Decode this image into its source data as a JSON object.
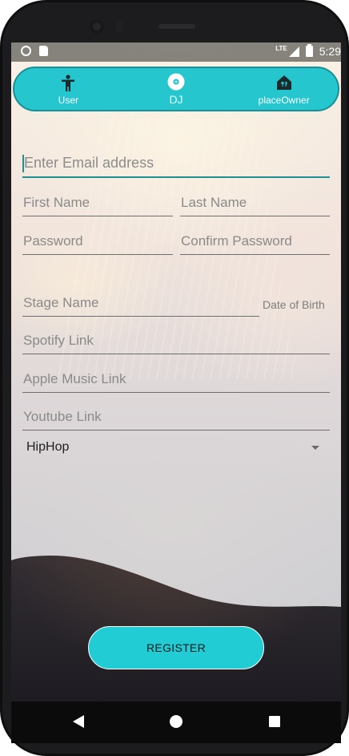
{
  "statusbar": {
    "network": "LTE",
    "time": "5:29"
  },
  "tabs": [
    {
      "label": "User",
      "icon": "accessibility-person-icon"
    },
    {
      "label": "DJ",
      "icon": "disc-icon",
      "selected": true
    },
    {
      "label": "placeOwner",
      "icon": "restaurant-home-icon"
    }
  ],
  "form": {
    "email_placeholder": "Enter Email address",
    "first_name_placeholder": "First Name",
    "last_name_placeholder": "Last Name",
    "password_placeholder": "Password",
    "confirm_password_placeholder": "Confirm Password",
    "stage_name_placeholder": "Stage Name",
    "dob_label": "Date of Birth",
    "spotify_placeholder": "Spotify Link",
    "apple_music_placeholder": "Apple Music Link",
    "youtube_placeholder": "Youtube Link",
    "genre_value": "HipHop"
  },
  "register_label": "REGISTER",
  "colors": {
    "accent": "#26c6cf",
    "accent_dark": "#1e8f92",
    "button": "#22ccd5"
  }
}
